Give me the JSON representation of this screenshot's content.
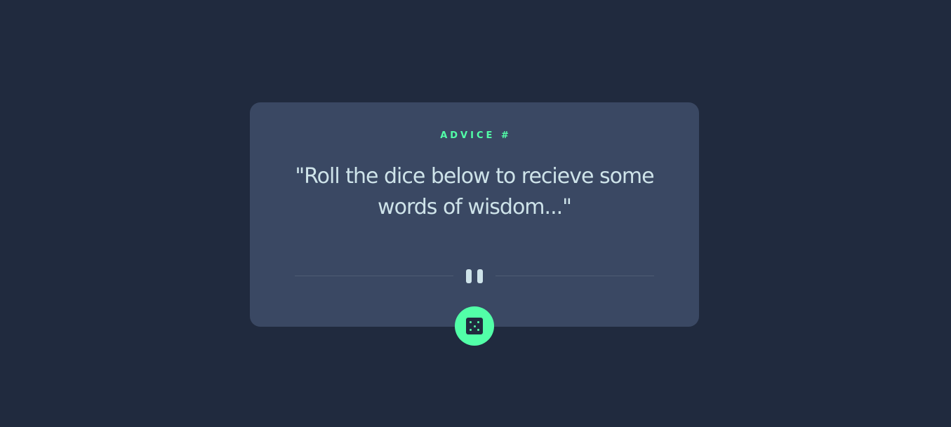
{
  "card": {
    "label": "ADVICE #",
    "quote": "\"Roll the dice below to recieve some words of wisdom...\""
  },
  "icons": {
    "divider": "pause-icon",
    "button": "dice-icon"
  },
  "colors": {
    "background": "#202a3e",
    "card": "#3a4863",
    "accent": "#52ffa8",
    "text": "#cee3e9"
  }
}
